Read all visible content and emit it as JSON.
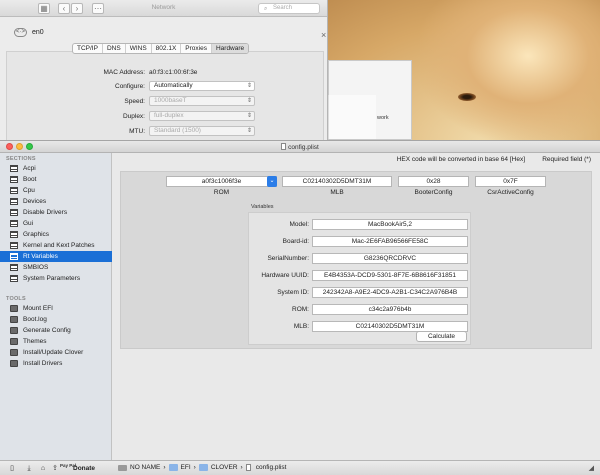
{
  "network": {
    "title": "Network",
    "search_placeholder": "Search",
    "interface": "en0",
    "tabs": [
      "TCP/IP",
      "DNS",
      "WINS",
      "802.1X",
      "Proxies",
      "Hardware"
    ],
    "mac_label": "MAC Address:",
    "mac_value": "a0:f3:c1:00:6f:3e",
    "configure_label": "Configure:",
    "configure_value": "Automatically",
    "speed_label": "Speed:",
    "speed_value": "1000baseT",
    "duplex_label": "Duplex:",
    "duplex_value": "full-duplex",
    "mtu_label": "MTU:",
    "mtu_value": "Standard (1500)"
  },
  "background_text": "work",
  "window": {
    "title": "config.plist"
  },
  "sidebar": {
    "sections_label": "SECTIONS",
    "sections": [
      "Acpi",
      "Boot",
      "Cpu",
      "Devices",
      "Disable Drivers",
      "Gui",
      "Graphics",
      "Kernel and Kext Patches",
      "Rt Variables",
      "SMBIOS",
      "System Parameters"
    ],
    "selected": "Rt Variables",
    "tools_label": "TOOLS",
    "tools": [
      "Mount EFI",
      "Boot.log",
      "Generate Config",
      "Themes",
      "Install/Update Clover",
      "Install Drivers"
    ]
  },
  "header": {
    "hex_note": "HEX code will be converted in base 64 [Hex]",
    "required_note": "Required field (*)"
  },
  "top_fields": {
    "rom": {
      "value": "a0f3c1006f3e",
      "label": "ROM"
    },
    "mlb": {
      "value": "C02140302D5DMT31M",
      "label": "MLB"
    },
    "booterconfig": {
      "value": "0x28",
      "label": "BooterConfig"
    },
    "csr": {
      "value": "0x7F",
      "label": "CsrActiveConfig"
    }
  },
  "variables": {
    "title": "Variables",
    "rows": [
      {
        "label": "Model:",
        "value": "MacBookAir5,2"
      },
      {
        "label": "Board-id:",
        "value": "Mac-2E6FAB96566FE58C"
      },
      {
        "label": "SerialNumber:",
        "value": "G8236QRCDRVC"
      },
      {
        "label": "Hardware UUID:",
        "value": "E4B4353A-DCD9-5301-8F7E-6B8616F31851"
      },
      {
        "label": "System ID:",
        "value": "242342A8-A9E2-4DC9-A2B1-C34C2A976B4B"
      },
      {
        "label": "ROM:",
        "value": "c34c2a976b4b"
      },
      {
        "label": "MLB:",
        "value": "C02140302D5DMT31M"
      }
    ],
    "calculate_label": "Calculate"
  },
  "bottombar": {
    "paypal": "Pay Pal",
    "donate": "Donate",
    "path": [
      "NO NAME",
      "EFI",
      "CLOVER",
      "config.plist"
    ]
  }
}
